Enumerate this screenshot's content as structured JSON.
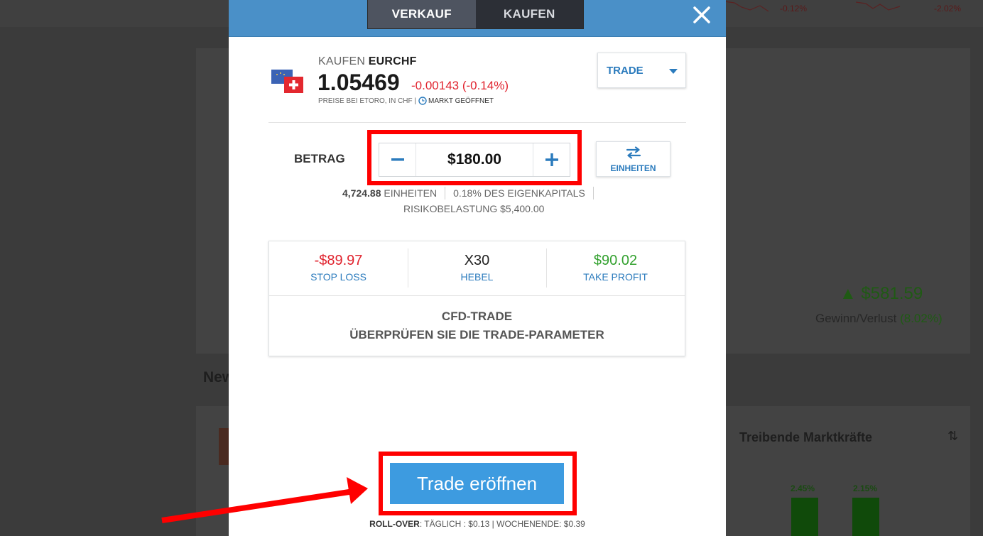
{
  "background": {
    "top_pct_1": "-0.12%",
    "top_pct_2": "-2.02%",
    "profit_value": "▲ $581.59",
    "profit_label": "Gewinn/Verlust",
    "profit_pct": "(8.02%)",
    "news_heading": "New",
    "market_forces_title": "Treibende Marktkräfte",
    "bar_pct_1": "2.45%",
    "bar_pct_2": "2.15%"
  },
  "tabs": {
    "sell": "VERKAUF",
    "buy": "KAUFEN"
  },
  "instrument": {
    "action": "KAUFEN",
    "symbol": "EURCHF",
    "price": "1.05469",
    "change": "-0.00143 (-0.14%)",
    "price_note": "PREISE BEI ETORO, IN CHF |",
    "market_status": "MARKT GEÖFFNET"
  },
  "order_type": {
    "selected": "TRADE"
  },
  "amount": {
    "label": "BETRAG",
    "value": "$180.00",
    "units_button": "EINHEITEN"
  },
  "info": {
    "units_value": "4,724.88",
    "units_label": "EINHEITEN",
    "equity": "0.18% DES EIGENKAPITALS",
    "risk": "RISIKOBELASTUNG $5,400.00"
  },
  "params": {
    "stop_loss_value": "-$89.97",
    "stop_loss_label": "STOP LOSS",
    "leverage_value": "X30",
    "leverage_label": "HEBEL",
    "take_profit_value": "$90.02",
    "take_profit_label": "TAKE PROFIT",
    "cfd_title": "CFD-TRADE",
    "cfd_subtitle": "ÜBERPRÜFEN SIE DIE TRADE-PARAMETER"
  },
  "open_button": "Trade eröffnen",
  "rollover": {
    "label": "ROLL-OVER",
    "details": ": TÄGLICH : $0.13 | WOCHENENDE: $0.39"
  },
  "colors": {
    "header_blue": "#4a90c8",
    "accent_blue": "#2b7bbd",
    "button_blue": "#3d9be0",
    "negative_red": "#e0232e",
    "positive_green": "#33a12f",
    "highlight_red": "#ff0000"
  }
}
